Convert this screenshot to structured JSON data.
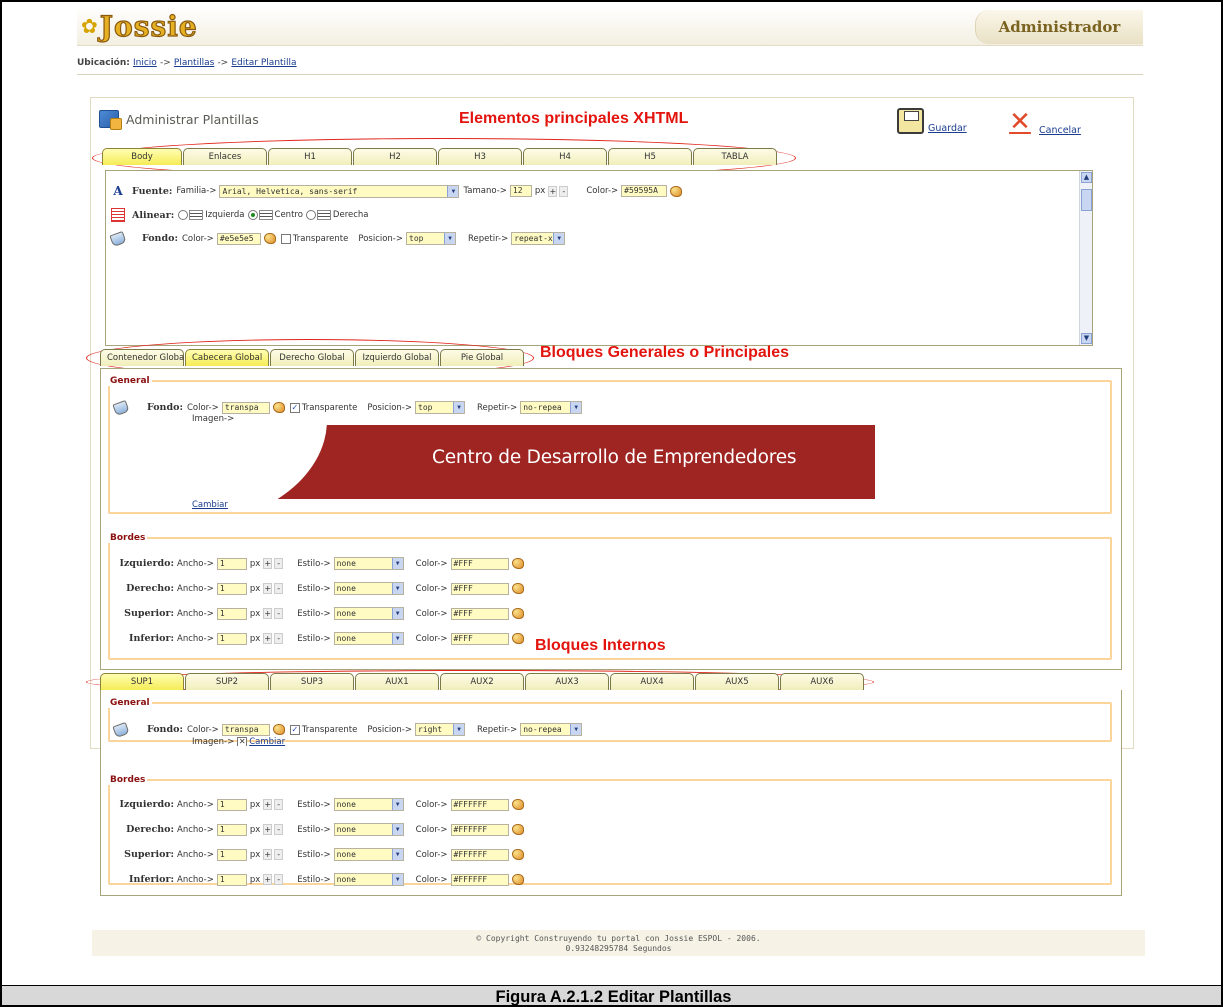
{
  "app": {
    "logo_text": "Jossie",
    "role": "Administrador"
  },
  "breadcrumb": {
    "label": "Ubicación:",
    "items": [
      "Inicio",
      "Plantillas",
      "Editar Plantilla"
    ],
    "sep": "->"
  },
  "page": {
    "title": "Administrar Plantillas",
    "save": "Guardar",
    "cancel": "Cancelar"
  },
  "notes": {
    "xhtml": "Elementos principales XHTML",
    "bloques": "Bloques Generales o Principales",
    "internos": "Bloques Internos"
  },
  "tabs1": {
    "items": [
      "Body",
      "Enlaces",
      "H1",
      "H2",
      "H3",
      "H4",
      "H5",
      "TABLA"
    ],
    "active": 0
  },
  "body_form": {
    "fuente": {
      "label": "Fuente:",
      "familia_label": "Familia->",
      "familia": "Arial, Helvetica, sans-serif",
      "tamano_label": "Tamano->",
      "tamano": "12",
      "unit": "px",
      "plus": "+",
      "minus": "-",
      "color_label": "Color->",
      "color": "#59595A"
    },
    "alinear": {
      "label": "Alinear:",
      "opciones": [
        "Izquierda",
        "Centro",
        "Derecha"
      ],
      "selected": "Centro"
    },
    "fondo": {
      "label": "Fondo:",
      "color_label": "Color->",
      "color": "#e5e5e5",
      "transparente": "Transparente",
      "posicion_label": "Posicion->",
      "posicion": "top",
      "repetir_label": "Repetir->",
      "repetir": "repeat-x"
    }
  },
  "tabs2": {
    "items": [
      "Contenedor Global",
      "Cabecera Global",
      "Derecho Global",
      "Izquierdo Global",
      "Pie Global"
    ],
    "active": 1
  },
  "global_form": {
    "general_legend": "General",
    "fondo": {
      "label": "Fondo:",
      "color_label": "Color->",
      "color": "transpa",
      "transparente": "Transparente",
      "posicion_label": "Posicion->",
      "posicion": "top",
      "repetir_label": "Repetir->",
      "repetir": "no-repea",
      "imagen_label": "Imagen->",
      "cambiar": "Cambiar"
    },
    "image_text": "Centro de Desarrollo de Emprendedores",
    "bordes_legend": "Bordes",
    "bordes": [
      {
        "label": "Izquierdo:",
        "ancho": "1",
        "estilo": "none",
        "color": "#FFF"
      },
      {
        "label": "Derecho:",
        "ancho": "1",
        "estilo": "none",
        "color": "#FFF"
      },
      {
        "label": "Superior:",
        "ancho": "1",
        "estilo": "none",
        "color": "#FFF"
      },
      {
        "label": "Inferior:",
        "ancho": "1",
        "estilo": "none",
        "color": "#FFF"
      }
    ]
  },
  "tabs3": {
    "items": [
      "SUP1",
      "SUP2",
      "SUP3",
      "AUX1",
      "AUX2",
      "AUX3",
      "AUX4",
      "AUX5",
      "AUX6"
    ],
    "active": 0
  },
  "internal_form": {
    "general_legend": "General",
    "fondo": {
      "label": "Fondo:",
      "color_label": "Color->",
      "color": "transpa",
      "transparente": "Transparente",
      "posicion_label": "Posicion->",
      "posicion": "right",
      "repetir_label": "Repetir->",
      "repetir": "no-repea",
      "imagen_label": "Imagen->",
      "cambiar": "Cambiar"
    },
    "bordes_legend": "Bordes",
    "bordes": [
      {
        "label": "Izquierdo:",
        "ancho": "1",
        "estilo": "none",
        "color": "#FFFFFF"
      },
      {
        "label": "Derecho:",
        "ancho": "1",
        "estilo": "none",
        "color": "#FFFFFF"
      },
      {
        "label": "Superior:",
        "ancho": "1",
        "estilo": "none",
        "color": "#FFFFFF"
      },
      {
        "label": "Inferior:",
        "ancho": "1",
        "estilo": "none",
        "color": "#FFFFFF"
      }
    ]
  },
  "border_row_labels": {
    "ancho": "Ancho->",
    "unit": "px",
    "plus": "+",
    "minus": "-",
    "estilo": "Estilo->",
    "color": "Color->"
  },
  "footer": {
    "line1": "© Copyright Construyendo tu portal con Jossie ESPOL - 2006.",
    "line2": "0.93248295784 Segundos"
  },
  "caption": "Figura A.2.1.2 Editar Plantillas",
  "colors": {
    "note_red": "#e3140e",
    "active_tab": "#f5ec55",
    "fieldset_border": "#fbd49a",
    "image_red": "#9e2521"
  }
}
